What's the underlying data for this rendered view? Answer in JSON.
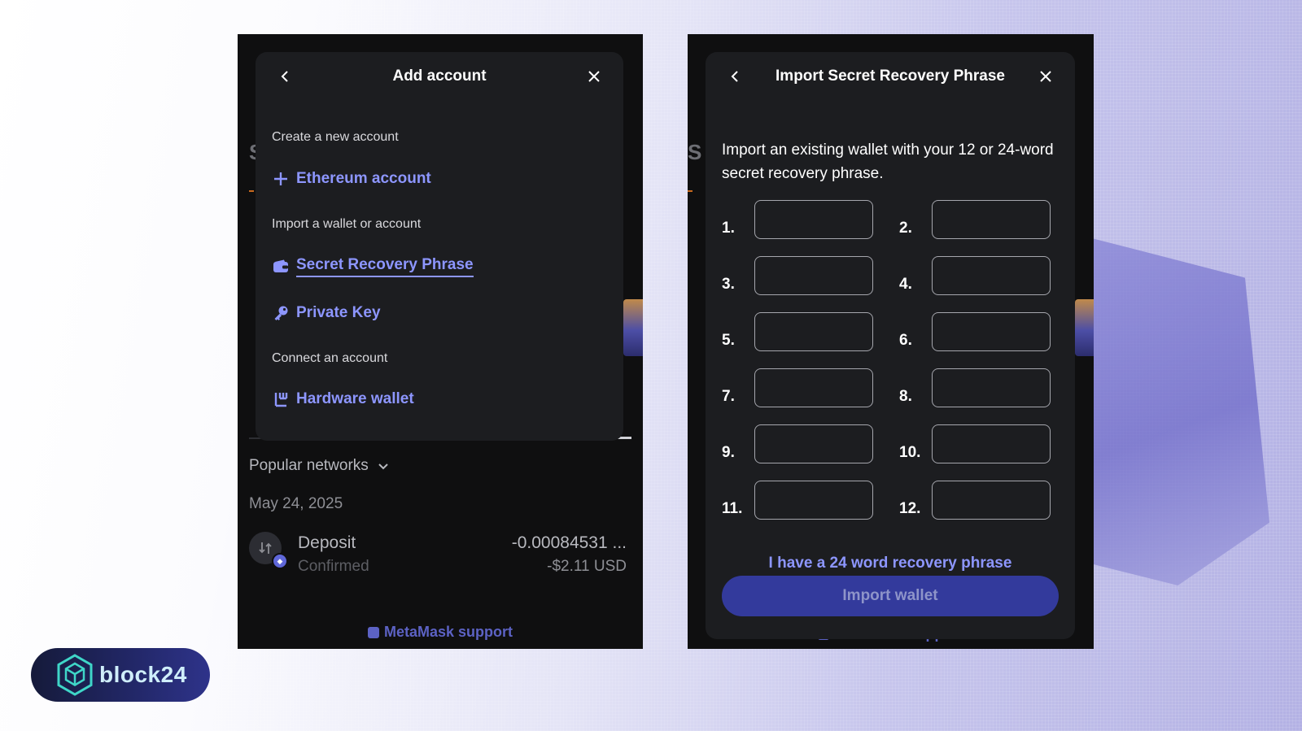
{
  "left_panel": {
    "modal": {
      "title": "Add account",
      "section_create": "Create a new account",
      "ethereum_account": "Ethereum account",
      "section_import": "Import a wallet or account",
      "secret_recovery_phrase": "Secret Recovery Phrase",
      "private_key": "Private Key",
      "section_connect": "Connect an account",
      "hardware_wallet": "Hardware wallet"
    },
    "background": {
      "popular_networks": "Popular networks",
      "date": "May 24, 2025",
      "tx_title": "Deposit",
      "tx_status": "Confirmed",
      "tx_amount": "-0.00084531 ...",
      "tx_fiat": "-$2.11 USD",
      "support": "MetaMask support"
    }
  },
  "right_panel": {
    "modal": {
      "title": "Import Secret Recovery Phrase",
      "description": "Import an existing wallet with your 12 or 24-word secret recovery phrase.",
      "word_labels": [
        "1.",
        "2.",
        "3.",
        "4.",
        "5.",
        "6.",
        "7.",
        "8.",
        "9.",
        "10.",
        "11.",
        "12."
      ],
      "word_values": [
        "",
        "",
        "",
        "",
        "",
        "",
        "",
        "",
        "",
        "",
        "",
        ""
      ],
      "link_24": "I have a 24 word recovery phrase",
      "import_button": "Import wallet"
    },
    "background": {
      "support": "MetaMask support"
    }
  },
  "logo": {
    "text": "block24"
  },
  "colors": {
    "accent": "#8d96ff",
    "modal_bg": "#1c1d20",
    "screen_bg": "#0f0f10",
    "button_disabled": "#333a9c"
  }
}
